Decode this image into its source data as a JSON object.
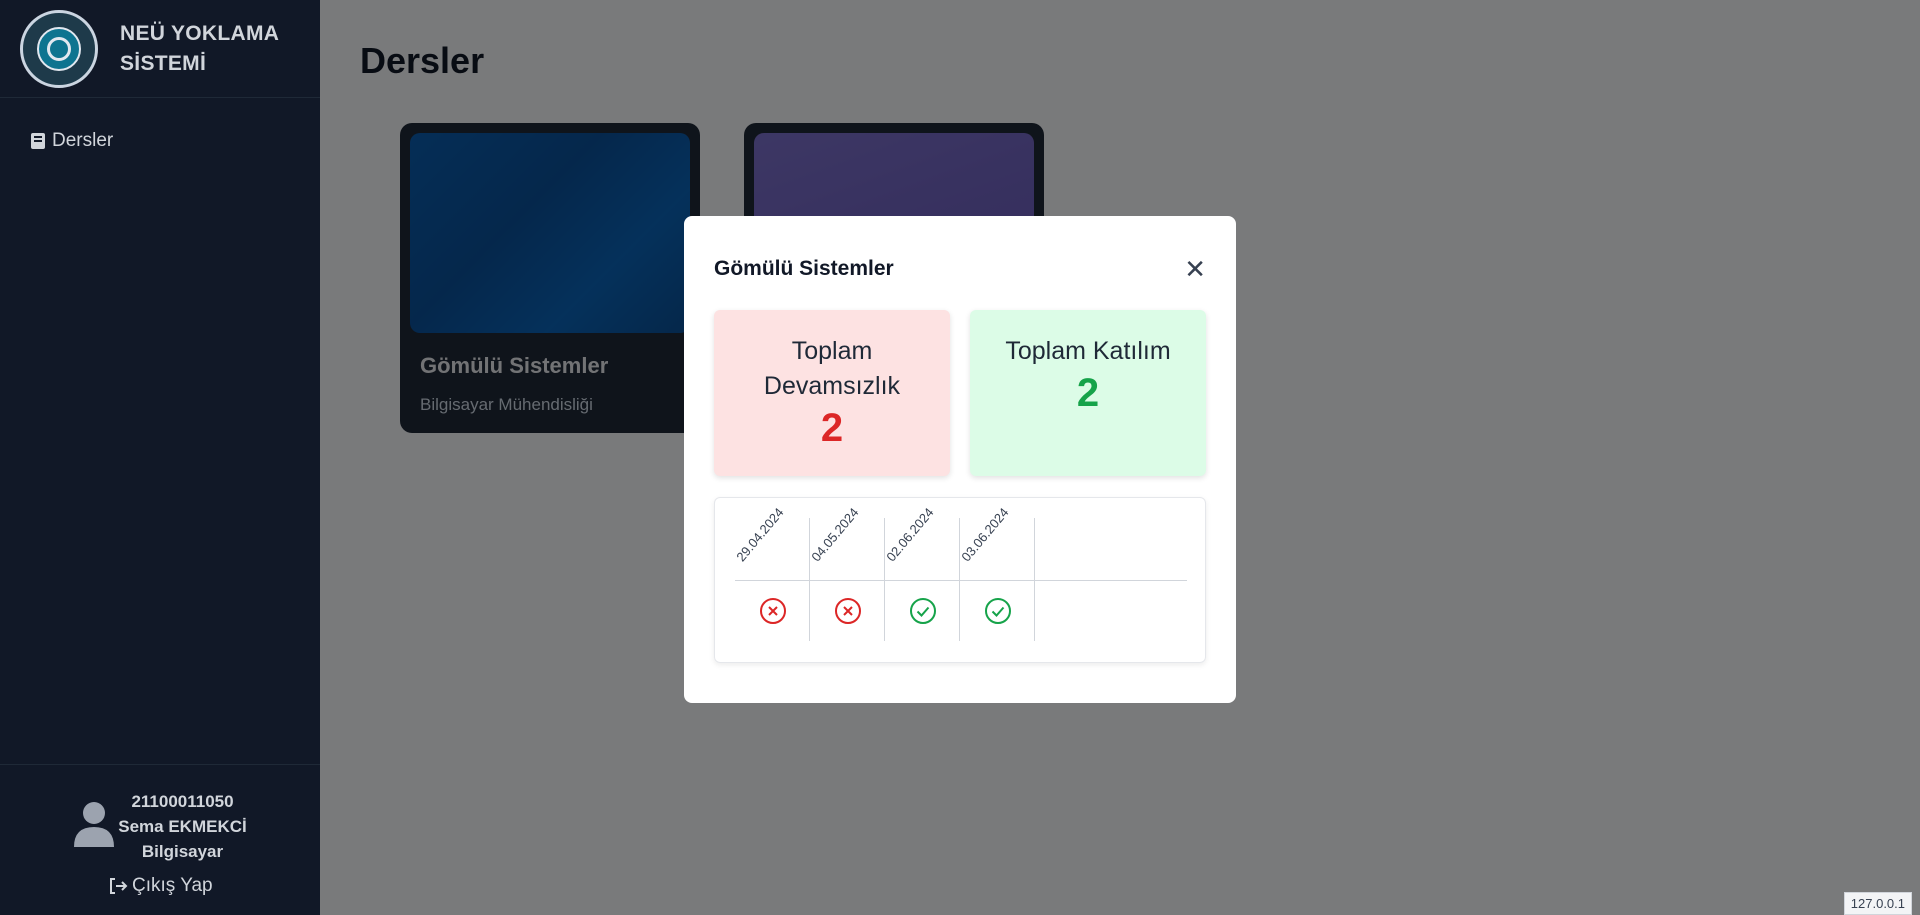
{
  "sidebar": {
    "brand": "NEÜ YOKLAMA SİSTEMİ",
    "nav": [
      {
        "label": "Dersler",
        "icon": "book-icon"
      }
    ],
    "user": {
      "id": "21100011050",
      "name": "Sema EKMEKCİ",
      "dept": "Bilgisayar"
    },
    "logout_label": "Çıkış Yap"
  },
  "main": {
    "title": "Dersler",
    "courses": [
      {
        "name": "Gömülü Sistemler",
        "dept": "Bilgisayar Mühendisliği",
        "color": "#0b5cad"
      },
      {
        "name": "",
        "dept": "",
        "color": "#6f62bf"
      }
    ]
  },
  "modal": {
    "title": "Gömülü Sistemler",
    "absence_label": "Toplam Devamsızlık",
    "absence_value": "2",
    "attendance_label": "Toplam Katılım",
    "attendance_value": "2",
    "records": [
      {
        "date": "29.04.2024",
        "status": "absent"
      },
      {
        "date": "04.05.2024",
        "status": "absent"
      },
      {
        "date": "02.06.2024",
        "status": "present"
      },
      {
        "date": "03.06.2024",
        "status": "present"
      }
    ]
  },
  "footer": {
    "host": "127.0.0.1"
  },
  "colors": {
    "absent": "#dc2626",
    "present": "#16a34a",
    "sidebar": "#111827"
  }
}
